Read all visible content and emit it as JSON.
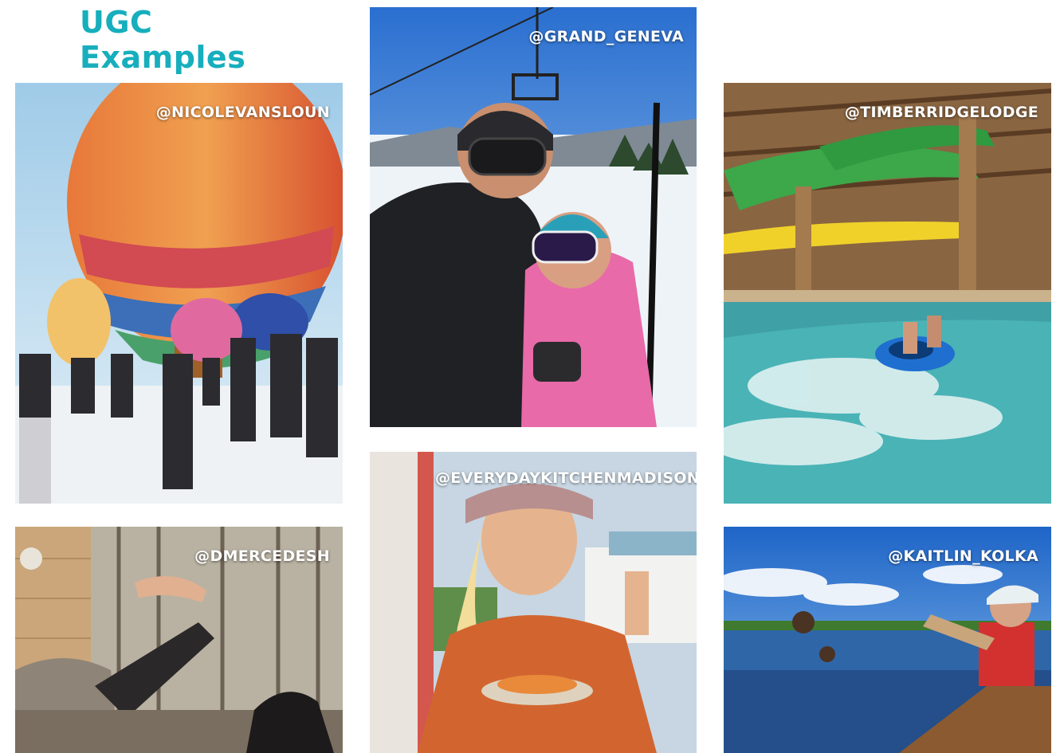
{
  "page": {
    "title": "UGC Examples",
    "accent_color": "#17aebd"
  },
  "tiles": [
    {
      "handle": "@NICOLEVANSLOUN",
      "subject": "hot-air-balloons"
    },
    {
      "handle": "@GRAND_GENEVA",
      "subject": "ski-lift-selfie"
    },
    {
      "handle": "@TIMBERRIDGELODGE",
      "subject": "indoor-waterpark"
    },
    {
      "handle": "@DMERCEDESH",
      "subject": "cabin-family"
    },
    {
      "handle": "@EVERYDAYKITCHENMADISON",
      "subject": "food-dining"
    },
    {
      "handle": "@KAITLIN_KOLKA",
      "subject": "canoe-lake"
    }
  ]
}
